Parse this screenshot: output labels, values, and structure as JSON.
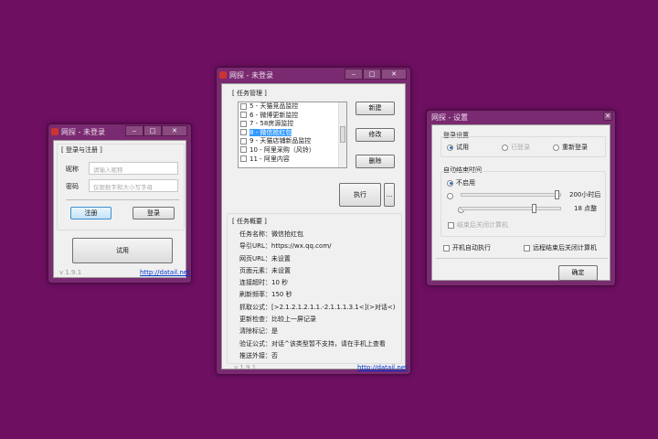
{
  "login_window": {
    "title": "网探 - 未登录",
    "group": "[ 登录与注册 ]",
    "nickname_label": "昵称",
    "nickname_placeholder": "请输入昵称",
    "password_label": "密码",
    "password_placeholder": "仅限数字和大小写字母",
    "register": "注册",
    "login": "登录",
    "trial": "试用",
    "version": "v 1.9.1",
    "link": "http://datail.net"
  },
  "task_window": {
    "title": "网探 - 未登录",
    "group": "[ 任务管理 ]",
    "tasks": [
      {
        "label": "5 - 天猫竞品监控",
        "checked": false,
        "selected": false
      },
      {
        "label": "6 - 微博更新监控",
        "checked": false,
        "selected": false
      },
      {
        "label": "7 - 58房源监控",
        "checked": false,
        "selected": false
      },
      {
        "label": "8 - 微信抢红包",
        "checked": false,
        "selected": true
      },
      {
        "label": "9 - 天猫店铺新品监控",
        "checked": false,
        "selected": false
      },
      {
        "label": "10 - 阿里采购（风铃）",
        "checked": false,
        "selected": false
      },
      {
        "label": "11 - 阿里内容",
        "checked": false,
        "selected": false
      }
    ],
    "new": "新建",
    "edit": "修改",
    "delete": "删除",
    "execute": "执行",
    "more": "...",
    "summary_group": "[ 任务概要 ]",
    "summary": [
      "任务名称：微信抢红包",
      "导引URL：https://wx.qq.com/",
      "网页URL：未设置",
      "页面元素：未设置",
      "连接超时：10 秒",
      "刷新频率：150 秒",
      "抓取公式：[>2.1.2.1.2.1.1.-2.1.1.1.3.1<](>对话<)",
      "更新检查：比较上一屏记录",
      "清除标记：是",
      "验证公式：对话^该类型暂不支持，请在手机上查看",
      "推送外接：否"
    ],
    "version": "v 1.9.1",
    "link": "http://datail.net"
  },
  "settings_window": {
    "title": "网探 - 设置",
    "login_group": "登录设置",
    "login_options": [
      {
        "label": "试用",
        "selected": true,
        "disabled": false
      },
      {
        "label": "已登录",
        "selected": false,
        "disabled": true
      },
      {
        "label": "重新登录",
        "selected": false,
        "disabled": false
      }
    ],
    "auto_end_group": "自动结束时间",
    "disable_option": "不启用",
    "hours_value": "200小时后",
    "hours_slider_fraction": 1.0,
    "clock_value": "18 点整",
    "clock_slider_fraction": 0.75,
    "shutdown_after": "结束后关闭计算机",
    "autostart": "开机自动执行",
    "remote_shutdown": "远程结束后关闭计算机",
    "ok": "确定"
  }
}
